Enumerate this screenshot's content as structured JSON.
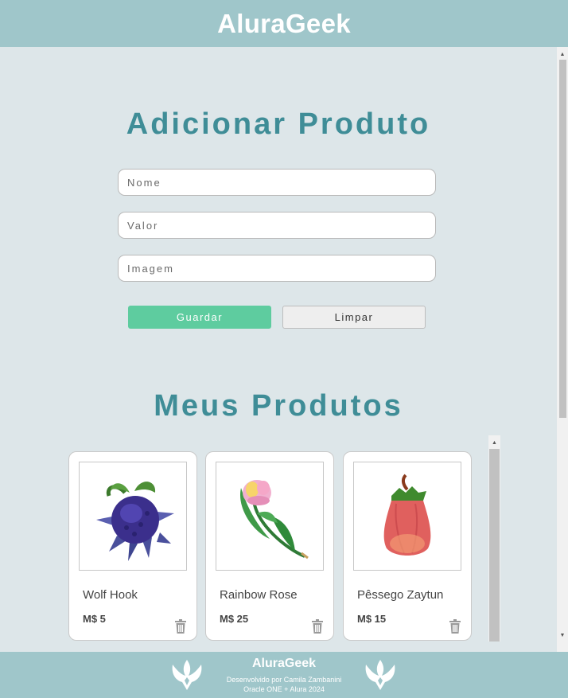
{
  "header": {
    "brand": "AluraGeek"
  },
  "form": {
    "title": "Adicionar Produto",
    "name_placeholder": "Nome",
    "value_placeholder": "Valor",
    "image_placeholder": "Imagem",
    "save_label": "Guardar",
    "clear_label": "Limpar"
  },
  "products": {
    "title": "Meus Produtos",
    "items": [
      {
        "name": "Wolf Hook",
        "price": "M$ 5",
        "icon": "wolf-hook-fruit-icon"
      },
      {
        "name": "Rainbow Rose",
        "price": "M$ 25",
        "icon": "rainbow-rose-flower-icon"
      },
      {
        "name": "Pêssego Zaytun",
        "price": "M$ 15",
        "icon": "zaytun-peach-fruit-icon"
      }
    ]
  },
  "footer": {
    "brand": "AluraGeek",
    "line1": "Desenvolvido por Camila Zambanini",
    "line2": "Oracle ONE + Alura 2024"
  },
  "colors": {
    "header_bg": "#9fc6ca",
    "page_bg": "#dde6e9",
    "title": "#3f8d97",
    "save_button": "#5ecc9f"
  }
}
